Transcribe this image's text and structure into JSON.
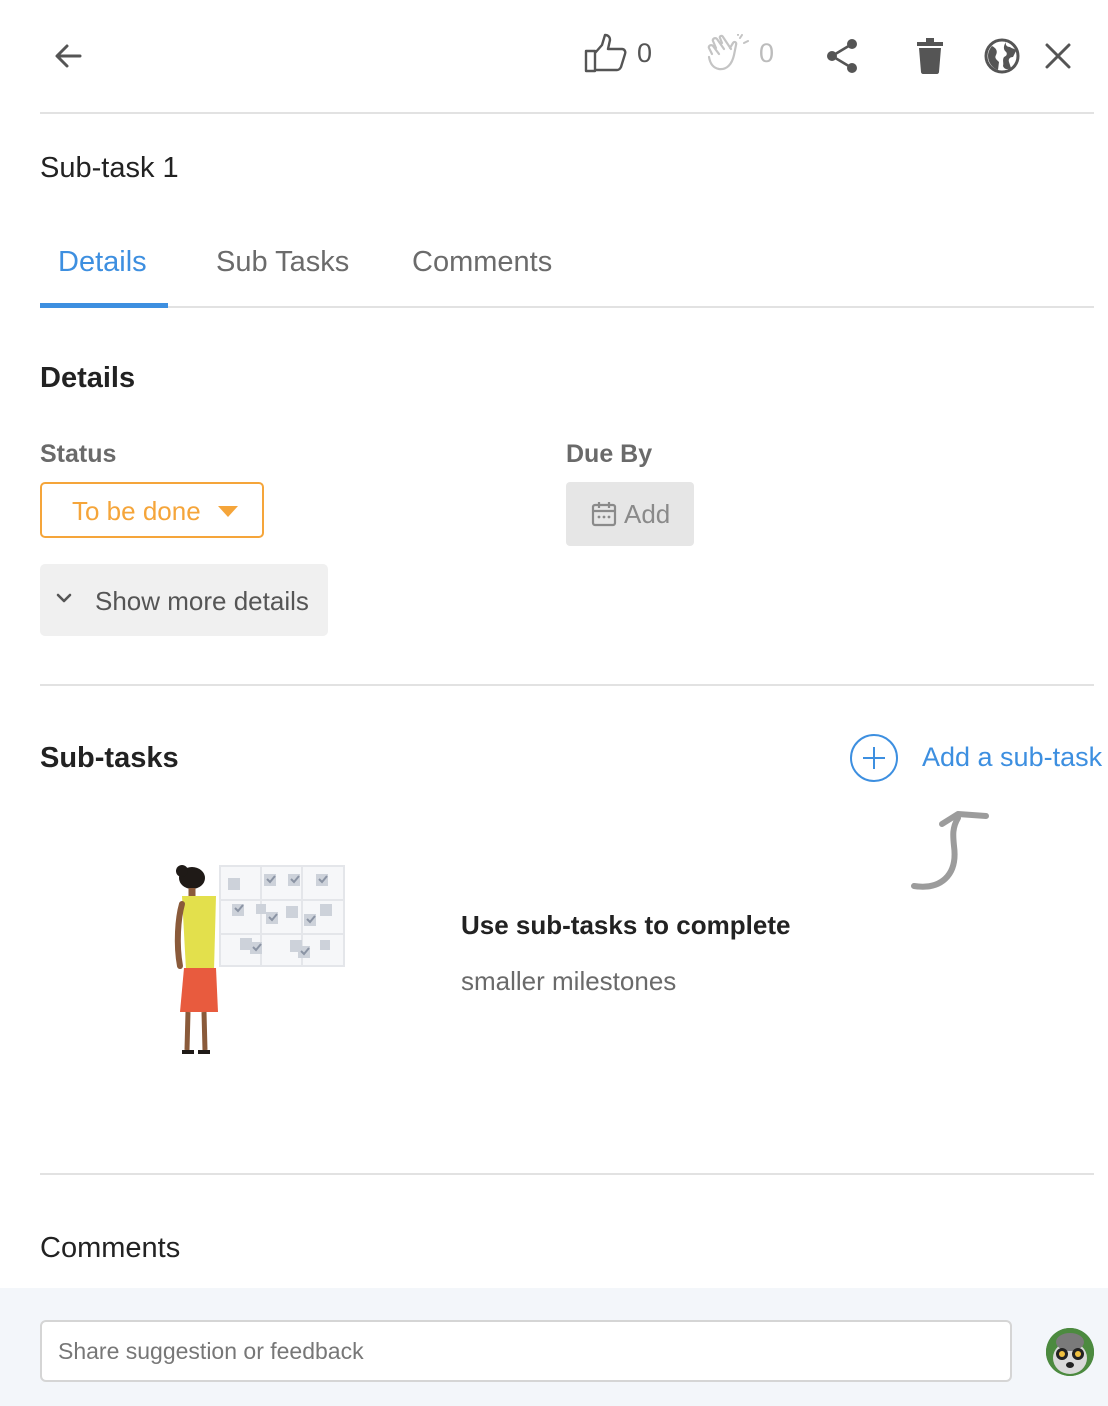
{
  "toolbar": {
    "like_count": "0",
    "clap_count": "0"
  },
  "task": {
    "title": "Sub-task 1"
  },
  "tabs": [
    {
      "label": "Details",
      "active": true
    },
    {
      "label": "Sub Tasks",
      "active": false
    },
    {
      "label": "Comments",
      "active": false
    }
  ],
  "details": {
    "heading": "Details",
    "status_label": "Status",
    "status_value": "To be done",
    "due_label": "Due By",
    "due_button": "Add",
    "show_more": "Show more details"
  },
  "subtasks": {
    "heading": "Sub-tasks",
    "add_label": "Add a sub-task",
    "empty_title": "Use sub-tasks to complete",
    "empty_subtitle": "smaller milestones"
  },
  "comments": {
    "heading": "Comments",
    "placeholder": "Share suggestion or feedback",
    "value": ""
  },
  "colors": {
    "accent": "#3d8fe0",
    "status": "#f5a53a",
    "divider": "#e2e2e2"
  },
  "icons": [
    "back-arrow-icon",
    "thumbs-up-icon",
    "clap-icon",
    "share-icon",
    "trash-icon",
    "globe-icon",
    "close-icon",
    "calendar-icon",
    "chevron-down-icon",
    "plus-circle-icon",
    "curved-arrow-icon"
  ]
}
